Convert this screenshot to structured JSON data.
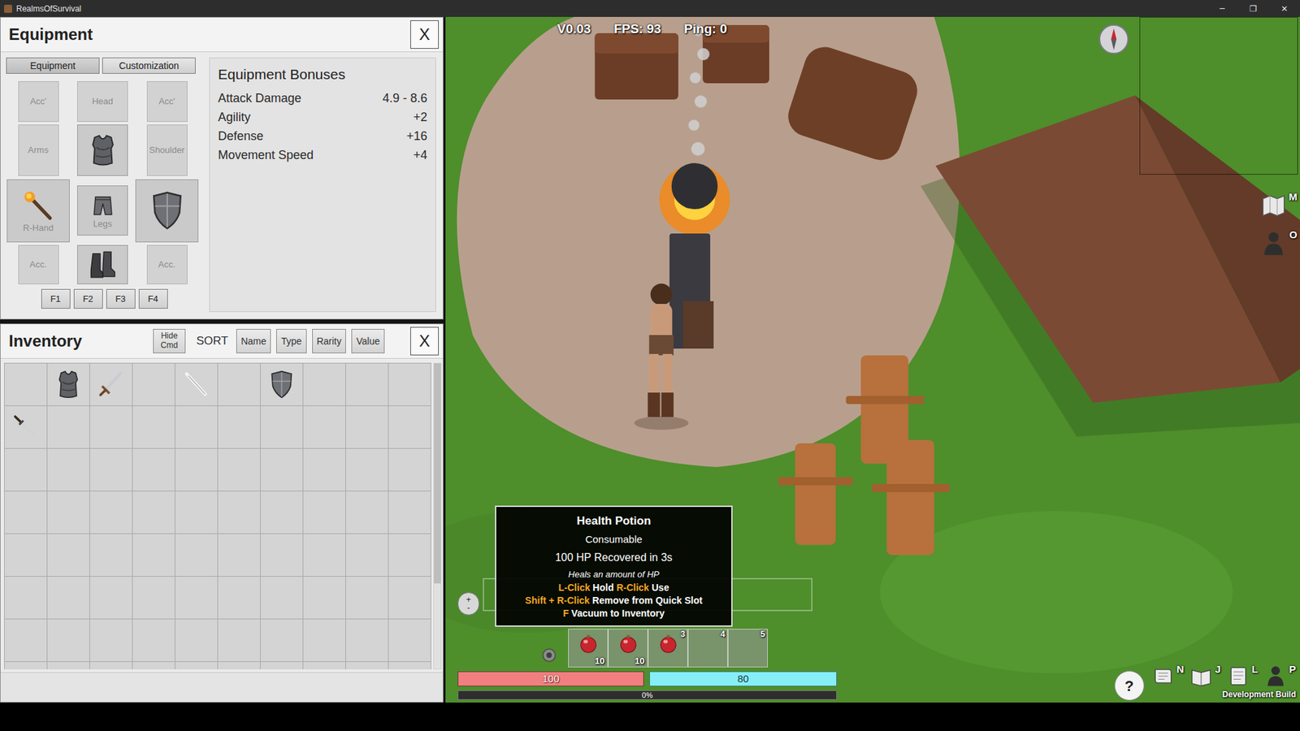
{
  "window": {
    "title": "RealmsOfSurvival",
    "controls": [
      "─",
      "❐",
      "✕"
    ]
  },
  "equipment": {
    "title": "Equipment",
    "close": "X",
    "tabs": [
      {
        "label": "Equipment",
        "selected": true
      },
      {
        "label": "Customization",
        "selected": false
      }
    ],
    "slots": [
      {
        "label": "Acc'",
        "kind": "empty"
      },
      {
        "label": "Head",
        "kind": "empty"
      },
      {
        "label": "Acc'",
        "kind": "empty"
      },
      {
        "label": "Arms",
        "kind": "empty"
      },
      {
        "kind": "armor"
      },
      {
        "label": "Shoulder",
        "kind": "empty"
      },
      {
        "label": "R-Hand",
        "kind": "torch"
      },
      {
        "label": "Legs",
        "kind": "pants"
      },
      {
        "kind": "shield"
      },
      {
        "label": "Acc.",
        "kind": "empty"
      },
      {
        "kind": "boots"
      },
      {
        "label": "Acc.",
        "kind": "empty"
      }
    ],
    "presets": [
      "F1",
      "F2",
      "F3",
      "F4"
    ],
    "bonuses": {
      "title": "Equipment Bonuses",
      "rows": [
        {
          "name": "Attack Damage",
          "value": "4.9 - 8.6"
        },
        {
          "name": "Agility",
          "value": "+2"
        },
        {
          "name": "Defense",
          "value": "+16"
        },
        {
          "name": "Movement Speed",
          "value": "+4"
        }
      ]
    }
  },
  "inventory": {
    "title": "Inventory",
    "hide_command": "Hide Cmd",
    "sort_label": "SORT",
    "sort_buttons": [
      "Name",
      "Type",
      "Rarity",
      "Value"
    ],
    "close": "X",
    "scrollbar": {
      "level": 0.72
    },
    "slots": [
      "empty",
      "armor",
      "sword",
      "empty",
      "blade",
      "empty",
      "shield",
      "empty",
      "empty",
      "empty",
      "dagger",
      "empty",
      "empty",
      "empty",
      "empty",
      "empty",
      "empty",
      "empty",
      "empty",
      "empty",
      "empty",
      "empty",
      "empty",
      "empty",
      "empty",
      "empty",
      "empty",
      "empty",
      "empty",
      "empty",
      "empty",
      "empty",
      "empty",
      "empty",
      "empty",
      "empty",
      "empty",
      "empty",
      "empty",
      "empty",
      "empty",
      "empty",
      "empty",
      "empty",
      "empty",
      "empty",
      "empty",
      "empty",
      "empty",
      "empty",
      "empty",
      "empty",
      "empty",
      "empty",
      "empty",
      "empty",
      "empty",
      "empty",
      "empty",
      "empty",
      "empty",
      "empty",
      "empty",
      "empty",
      "empty",
      "empty",
      "empty",
      "empty",
      "empty",
      "empty",
      "empty",
      "empty",
      "empty",
      "empty",
      "empty",
      "empty",
      "empty",
      "empty",
      "empty",
      "empty"
    ]
  },
  "hud": {
    "version": "V0.03",
    "fps": "FPS: 93",
    "ping": "Ping: 0",
    "side_keys": [
      "M",
      "O"
    ],
    "menu_keys": [
      "N",
      "J",
      "L",
      "P"
    ],
    "help": "?",
    "build": "Development Build",
    "zoom": {
      "plus": "+",
      "minus": "-"
    }
  },
  "tooltip": {
    "title": "Health Potion",
    "type": "Consumable",
    "effect": "100 HP Recovered in 3s",
    "description": "Heals an amount of HP",
    "controls": [
      [
        {
          "text": "L-Click",
          "kind": "key"
        },
        {
          "text": " Hold ",
          "kind": "plain"
        },
        {
          "text": "R-Click",
          "kind": "key"
        },
        {
          "text": " Use",
          "kind": "plain"
        }
      ],
      [
        {
          "text": "Shift + R-Click",
          "kind": "key"
        },
        {
          "text": " Remove from Quick Slot",
          "kind": "plain"
        }
      ],
      [
        {
          "text": "F",
          "kind": "key"
        },
        {
          "text": " Vacuum to Inventory",
          "kind": "plain"
        }
      ]
    ]
  },
  "quickbar": {
    "slots": [
      {
        "count": "10",
        "kind": "potion"
      },
      {
        "count": "10",
        "kind": "potion"
      },
      {
        "number": "3",
        "kind": "potion"
      },
      {
        "number": "4",
        "kind": "empty"
      },
      {
        "number": "5",
        "kind": "empty"
      }
    ]
  },
  "bars": {
    "health": {
      "reading": "100",
      "level": 1
    },
    "mana": {
      "reading": "80",
      "level": 1
    },
    "experience": {
      "reading": "0%",
      "level": 0
    }
  }
}
